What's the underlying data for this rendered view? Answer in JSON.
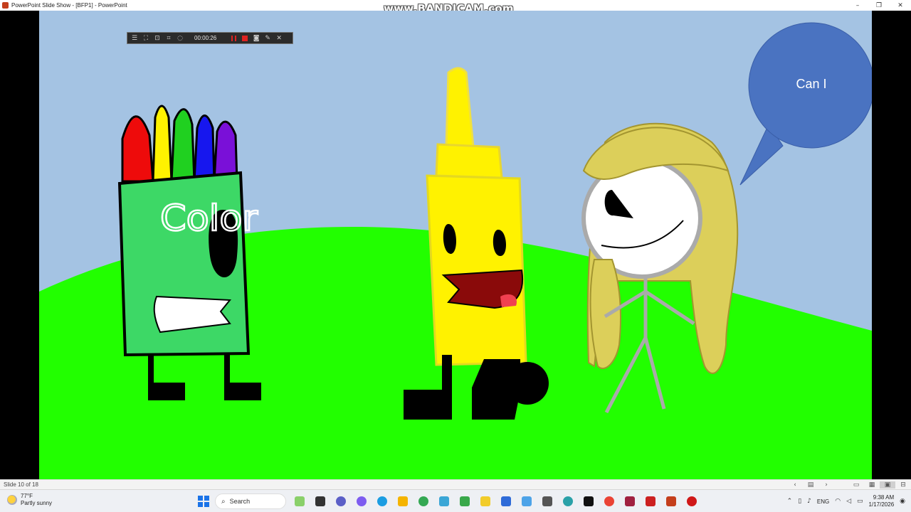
{
  "window": {
    "title": "PowerPoint Slide Show - [BFP1] - PowerPoint",
    "controls": {
      "minimize": "–",
      "restore": "❐",
      "close": "✕"
    }
  },
  "watermark": "www.BANDICAM.com",
  "recorder": {
    "time": "00:00:26"
  },
  "slide": {
    "colors": {
      "sky": "#a4c3e3",
      "grass": "#22ff00",
      "bubble": "#4a73c1"
    },
    "speech_bubble": {
      "text": "Can I"
    },
    "crayon_box_text": "Color"
  },
  "statusbar": {
    "slide_indicator": "Slide 10 of 18"
  },
  "taskbar": {
    "weather": {
      "temp": "77°F",
      "condition": "Partly sunny"
    },
    "search_placeholder": "Search",
    "language": "ENG",
    "clock": {
      "time": "9:38 AM",
      "date": "1/17/2026"
    },
    "apps": [
      {
        "name": "file-explorer-icon",
        "color": "#f5b400"
      },
      {
        "name": "edge-icon",
        "color": "#1b9de2"
      },
      {
        "name": "copilot-icon",
        "color": "#7d5cf0"
      },
      {
        "name": "chrome-icon",
        "color": "#34a853"
      },
      {
        "name": "powerpoint-icon",
        "color": "#c43e1c"
      },
      {
        "name": "bandicam-icon",
        "color": "#d01818"
      }
    ]
  }
}
